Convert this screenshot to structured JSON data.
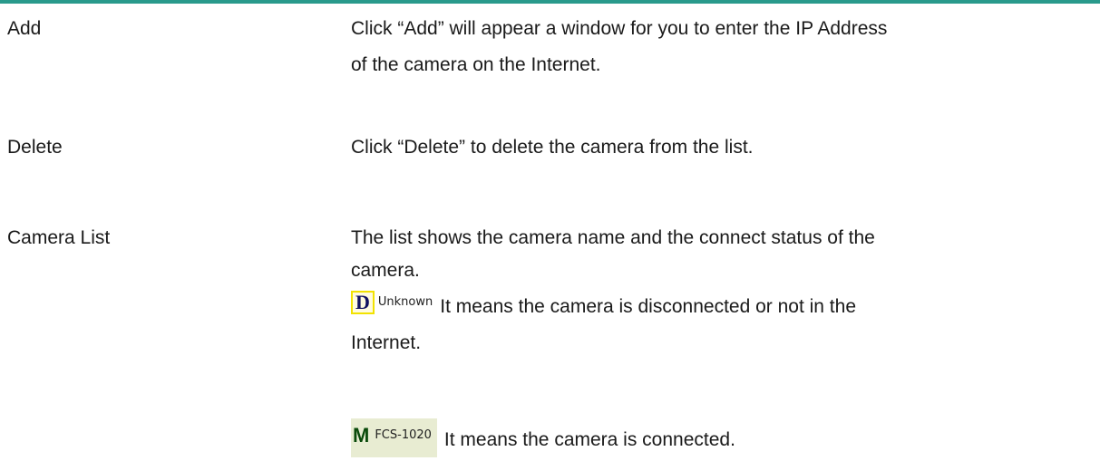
{
  "colors": {
    "top_rule": "#2a9a8c",
    "text": "#1a1a1a",
    "disconnected_badge_border": "#f2e200",
    "connected_badge_bg": "#e8ecd2"
  },
  "items": [
    {
      "term": "Add",
      "desc_lines": [
        "Click “Add” will appear a window for you to enter the IP Address",
        "of the camera on the Internet."
      ]
    },
    {
      "term": "Delete",
      "desc_lines": [
        "Click “Delete” to delete the camera from the list."
      ]
    },
    {
      "term": "Camera List",
      "desc_lines": [
        "The list shows the camera name and the connect status of the",
        "camera."
      ],
      "statuses": [
        {
          "icon_name": "disconnected-status-icon",
          "letter": "D",
          "name": "Unknown",
          "text": "It means the camera is disconnected or not in the",
          "text_continued": "Internet."
        },
        {
          "icon_name": "connected-status-icon",
          "letter": "M",
          "name": "FCS-1020",
          "text": "It means the camera is connected."
        }
      ]
    }
  ]
}
